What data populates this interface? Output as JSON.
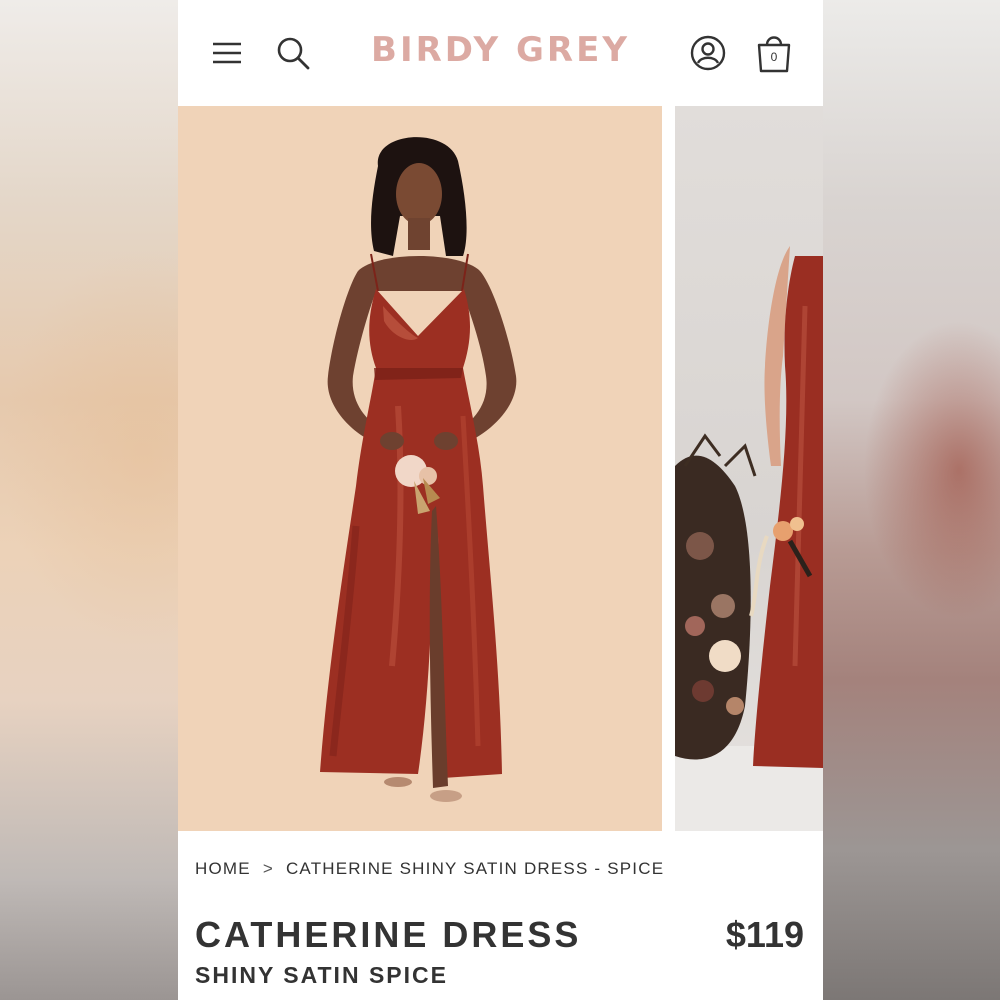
{
  "header": {
    "brand": "BIRDY GREY",
    "menu_icon": "hamburger-menu-icon",
    "search_icon": "search-icon",
    "account_icon": "account-icon",
    "bag_icon": "shopping-bag-icon",
    "bag_count": "0",
    "brand_color": "#dcaaa3"
  },
  "gallery": {
    "main_bg": "#f0d3b8",
    "dress_color": "#9c2f22"
  },
  "breadcrumb": {
    "home": "HOME",
    "separator": ">",
    "current": "CATHERINE SHINY SATIN DRESS - SPICE"
  },
  "product": {
    "title": "CATHERINE DRESS",
    "price": "$119",
    "subtitle": "SHINY SATIN SPICE"
  }
}
